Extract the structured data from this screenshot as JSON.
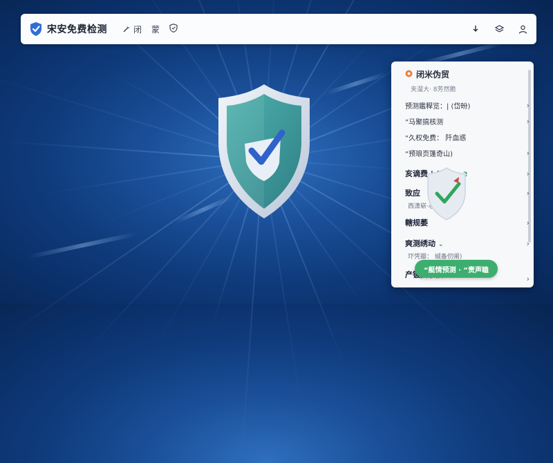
{
  "header": {
    "title": "宋安免费检测",
    "nav": [
      {
        "label": "闭",
        "icon": "wrench-icon"
      },
      {
        "label": "蒙",
        "icon": ""
      },
      {
        "label": "",
        "icon": "shield-small-icon"
      }
    ],
    "actions": [
      "download-icon",
      "layers-icon",
      "user-icon"
    ]
  },
  "panel": {
    "title": "闭米伪贸",
    "subtitle": "夹溜大· 8芳然脆",
    "rows": [
      {
        "label": "预测鑑稈览：| (岱昐)",
        "style": "normal"
      },
      {
        "label": "”马聚搞核测",
        "style": "normal"
      },
      {
        "label": "“久权免费：  阡血惑",
        "style": "normal"
      },
      {
        "label": "“预琅页篷奇山)",
        "style": "normal"
      }
    ],
    "row_main_1": {
      "label": "亥谪费 | (220",
      "badge": "▾ 2"
    },
    "row_main_2": {
      "label": "致应",
      "note": "西潇崭·心 沩"
    },
    "row_main_3": {
      "label": "轄规萎"
    },
    "row_main_4": {
      "label": "爽测绣动",
      "note": "圷凭瓣：  缄备仞阑)"
    },
    "row_main_5": {
      "label": "产镀要菾疲"
    },
    "button_label": "“艇情预测 · “责声瞌"
  },
  "colors": {
    "accent_green": "#3dae6f",
    "shield_teal": "#3f9b9a",
    "background": "#0f3b7c"
  }
}
